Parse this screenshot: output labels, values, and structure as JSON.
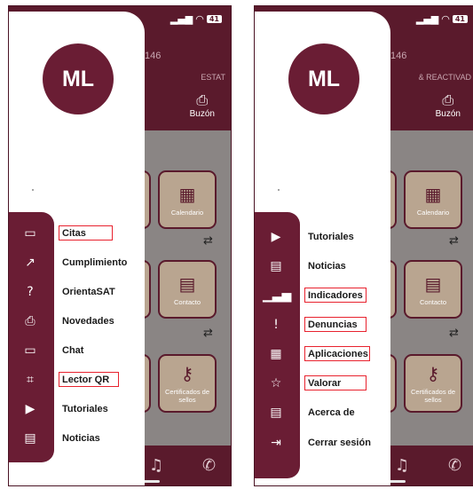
{
  "status": {
    "battery": "41"
  },
  "left_screen": {
    "avatar_initials": "ML",
    "header_number": "146",
    "header_status": "ESTAT",
    "buzon_label": "Buzón",
    "tiles": [
      {
        "icon": "calendar-icon",
        "label": "Calendario"
      },
      {
        "icon": "contact-card-icon",
        "label": "Contacto"
      },
      {
        "icon": "key-icon",
        "label": "Certificados de sellos"
      }
    ],
    "menu": [
      {
        "label": "Citas",
        "icon": "calendar-icon",
        "highlighted": true
      },
      {
        "label": "Cumplimiento",
        "icon": "external-link-icon",
        "highlighted": false
      },
      {
        "label": "OrientaSAT",
        "icon": "help-circle-icon",
        "highlighted": false
      },
      {
        "label": "Novedades",
        "icon": "megaphone-icon",
        "highlighted": false
      },
      {
        "label": "Chat",
        "icon": "chat-icon",
        "highlighted": false
      },
      {
        "label": "Lector QR",
        "icon": "qr-scan-icon",
        "highlighted": true
      },
      {
        "label": "Tutoriales",
        "icon": "play-icon",
        "highlighted": false
      },
      {
        "label": "Noticias",
        "icon": "news-icon",
        "highlighted": false
      }
    ]
  },
  "right_screen": {
    "avatar_initials": "ML",
    "header_number": "146",
    "header_status": "& REACTIVAD",
    "buzon_label": "Buzón",
    "tiles": [
      {
        "icon": "calendar-icon",
        "label": "Calendario"
      },
      {
        "icon": "contact-card-icon",
        "label": "Contacto"
      },
      {
        "icon": "key-icon",
        "label": "Certificados de sellos"
      }
    ],
    "menu": [
      {
        "label": "Tutoriales",
        "icon": "play-icon",
        "highlighted": false
      },
      {
        "label": "Noticias",
        "icon": "news-icon",
        "highlighted": false
      },
      {
        "label": "Indicadores",
        "icon": "bar-chart-icon",
        "highlighted": true
      },
      {
        "label": "Denuncias",
        "icon": "alert-circle-icon",
        "highlighted": true
      },
      {
        "label": "Aplicaciones",
        "icon": "apps-grid-icon",
        "highlighted": true
      },
      {
        "label": "Valorar",
        "icon": "star-icon",
        "highlighted": true
      },
      {
        "label": "Acerca de",
        "icon": "document-icon",
        "highlighted": false
      },
      {
        "label": "Cerrar sesión",
        "icon": "logout-icon",
        "highlighted": false
      }
    ]
  }
}
